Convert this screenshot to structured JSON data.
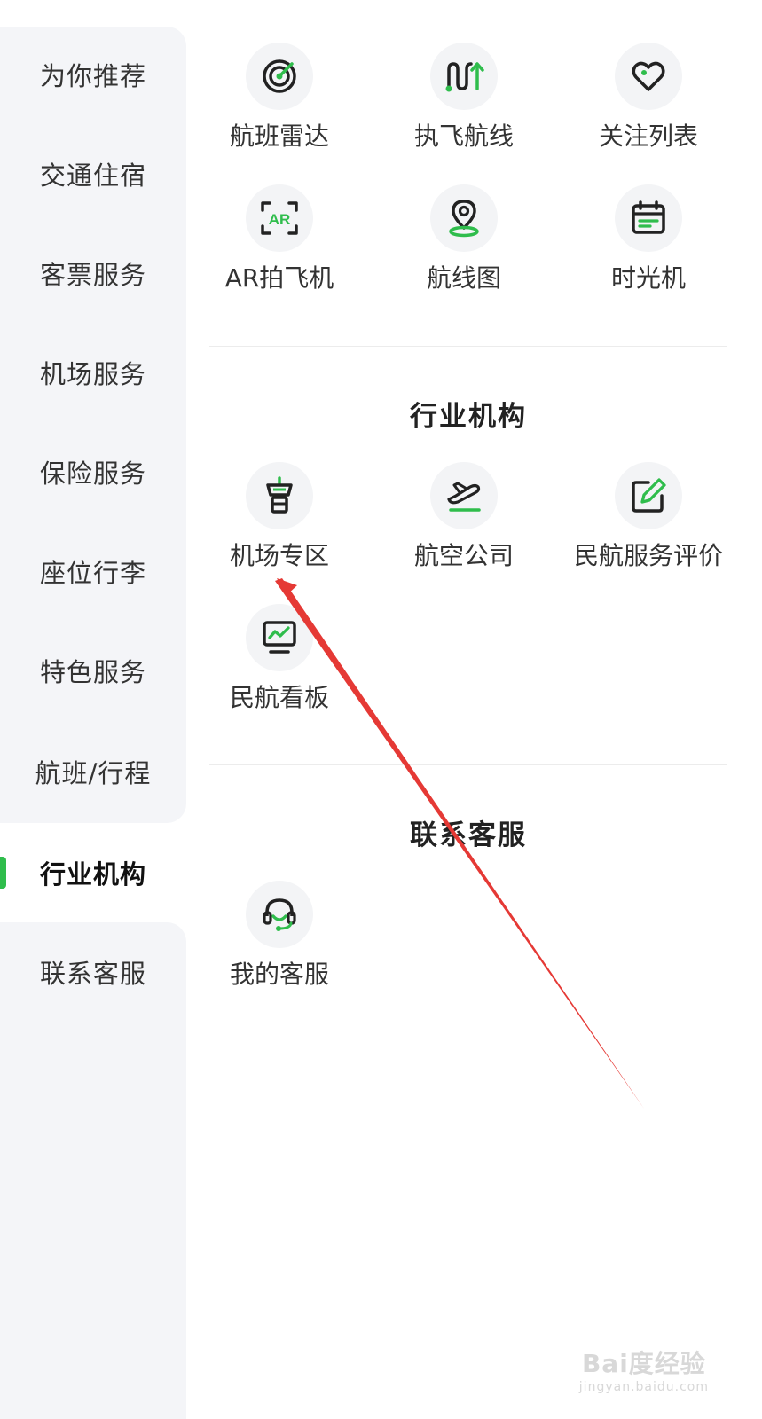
{
  "sidebar": {
    "items": [
      {
        "label": "为你推荐",
        "active": false
      },
      {
        "label": "交通住宿",
        "active": false
      },
      {
        "label": "客票服务",
        "active": false
      },
      {
        "label": "机场服务",
        "active": false
      },
      {
        "label": "保险服务",
        "active": false
      },
      {
        "label": "座位行李",
        "active": false
      },
      {
        "label": "特色服务",
        "active": false
      },
      {
        "label": "航班/行程",
        "active": false
      },
      {
        "label": "行业机构",
        "active": true
      },
      {
        "label": "联系客服",
        "active": false
      }
    ]
  },
  "featured": {
    "tiles": [
      {
        "label": "航班雷达",
        "icon": "radar-icon"
      },
      {
        "label": "执飞航线",
        "icon": "flight-route-icon"
      },
      {
        "label": "关注列表",
        "icon": "heart-icon"
      },
      {
        "label": "AR拍飞机",
        "icon": "ar-scan-icon"
      },
      {
        "label": "航线图",
        "icon": "map-pin-icon"
      },
      {
        "label": "时光机",
        "icon": "calendar-icon"
      }
    ]
  },
  "industry": {
    "title": "行业机构",
    "tiles": [
      {
        "label": "机场专区",
        "icon": "control-tower-icon"
      },
      {
        "label": "航空公司",
        "icon": "airplane-takeoff-icon"
      },
      {
        "label": "民航服务评价",
        "icon": "edit-icon"
      },
      {
        "label": "民航看板",
        "icon": "monitor-chart-icon"
      }
    ]
  },
  "contact": {
    "title": "联系客服",
    "tiles": [
      {
        "label": "我的客服",
        "icon": "headset-icon"
      }
    ]
  },
  "watermark": {
    "main": "Bai度经验",
    "sub": "jingyan.baidu.com"
  },
  "colors": {
    "accent": "#2fbd4c",
    "annotation_arrow": "#e53935"
  }
}
